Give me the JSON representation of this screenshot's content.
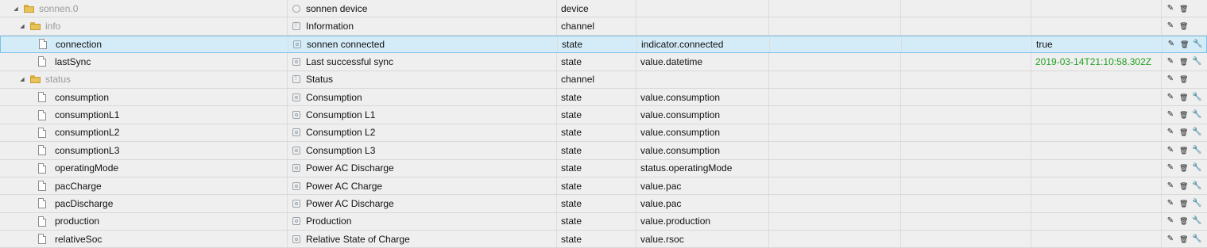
{
  "rows": [
    {
      "indent": 0,
      "kind": "folder",
      "expanded": true,
      "id": "sonnen.0",
      "id_grey": true,
      "name": "sonnen device",
      "name_icon": "device",
      "type": "device",
      "role": "",
      "value": "",
      "buttons": [
        "edit",
        "delete"
      ]
    },
    {
      "indent": 1,
      "kind": "folder",
      "expanded": true,
      "id": "info",
      "id_grey": true,
      "name": "Information",
      "name_icon": "channel",
      "type": "channel",
      "role": "",
      "value": "",
      "buttons": [
        "edit",
        "delete"
      ]
    },
    {
      "indent": 2,
      "kind": "file",
      "id": "connection",
      "name": "sonnen connected",
      "name_icon": "state",
      "type": "state",
      "role": "indicator.connected",
      "value": "true",
      "selected": true,
      "buttons": [
        "edit",
        "delete",
        "wrench"
      ]
    },
    {
      "indent": 2,
      "kind": "file",
      "id": "lastSync",
      "name": "Last successful sync",
      "name_icon": "state",
      "type": "state",
      "role": "value.datetime",
      "value": "2019-03-14T21:10:58.302Z",
      "value_color": "#22a022",
      "buttons": [
        "edit",
        "delete",
        "wrench"
      ]
    },
    {
      "indent": 1,
      "kind": "folder",
      "expanded": true,
      "id": "status",
      "id_grey": true,
      "name": "Status",
      "name_icon": "channel",
      "type": "channel",
      "role": "",
      "value": "",
      "buttons": [
        "edit",
        "delete"
      ]
    },
    {
      "indent": 2,
      "kind": "file",
      "id": "consumption",
      "name": "Consumption",
      "name_icon": "state",
      "type": "state",
      "role": "value.consumption",
      "value": "",
      "buttons": [
        "edit",
        "delete",
        "wrench"
      ]
    },
    {
      "indent": 2,
      "kind": "file",
      "id": "consumptionL1",
      "name": "Consumption L1",
      "name_icon": "state",
      "type": "state",
      "role": "value.consumption",
      "value": "",
      "buttons": [
        "edit",
        "delete",
        "wrench"
      ]
    },
    {
      "indent": 2,
      "kind": "file",
      "id": "consumptionL2",
      "name": "Consumption L2",
      "name_icon": "state",
      "type": "state",
      "role": "value.consumption",
      "value": "",
      "buttons": [
        "edit",
        "delete",
        "wrench"
      ]
    },
    {
      "indent": 2,
      "kind": "file",
      "id": "consumptionL3",
      "name": "Consumption L3",
      "name_icon": "state",
      "type": "state",
      "role": "value.consumption",
      "value": "",
      "buttons": [
        "edit",
        "delete",
        "wrench"
      ]
    },
    {
      "indent": 2,
      "kind": "file",
      "id": "operatingMode",
      "name": "Power AC Discharge",
      "name_icon": "state",
      "type": "state",
      "role": "status.operatingMode",
      "value": "",
      "buttons": [
        "edit",
        "delete",
        "wrench"
      ]
    },
    {
      "indent": 2,
      "kind": "file",
      "id": "pacCharge",
      "name": "Power AC Charge",
      "name_icon": "state",
      "type": "state",
      "role": "value.pac",
      "value": "",
      "buttons": [
        "edit",
        "delete",
        "wrench"
      ]
    },
    {
      "indent": 2,
      "kind": "file",
      "id": "pacDischarge",
      "name": "Power AC Discharge",
      "name_icon": "state",
      "type": "state",
      "role": "value.pac",
      "value": "",
      "buttons": [
        "edit",
        "delete",
        "wrench"
      ]
    },
    {
      "indent": 2,
      "kind": "file",
      "id": "production",
      "name": "Production",
      "name_icon": "state",
      "type": "state",
      "role": "value.production",
      "value": "",
      "buttons": [
        "edit",
        "delete",
        "wrench"
      ]
    },
    {
      "indent": 2,
      "kind": "file",
      "id": "relativeSoc",
      "name": "Relative State of Charge",
      "name_icon": "state",
      "type": "state",
      "role": "value.rsoc",
      "value": "",
      "buttons": [
        "edit",
        "delete",
        "wrench"
      ]
    }
  ],
  "button_icons": {
    "edit": "pencil-icon",
    "delete": "trash-icon",
    "wrench": "wrench-icon"
  },
  "colors": {
    "selected_bg": "#d4ecf8",
    "value_green": "#22a022",
    "folder": "#e8c35c"
  }
}
